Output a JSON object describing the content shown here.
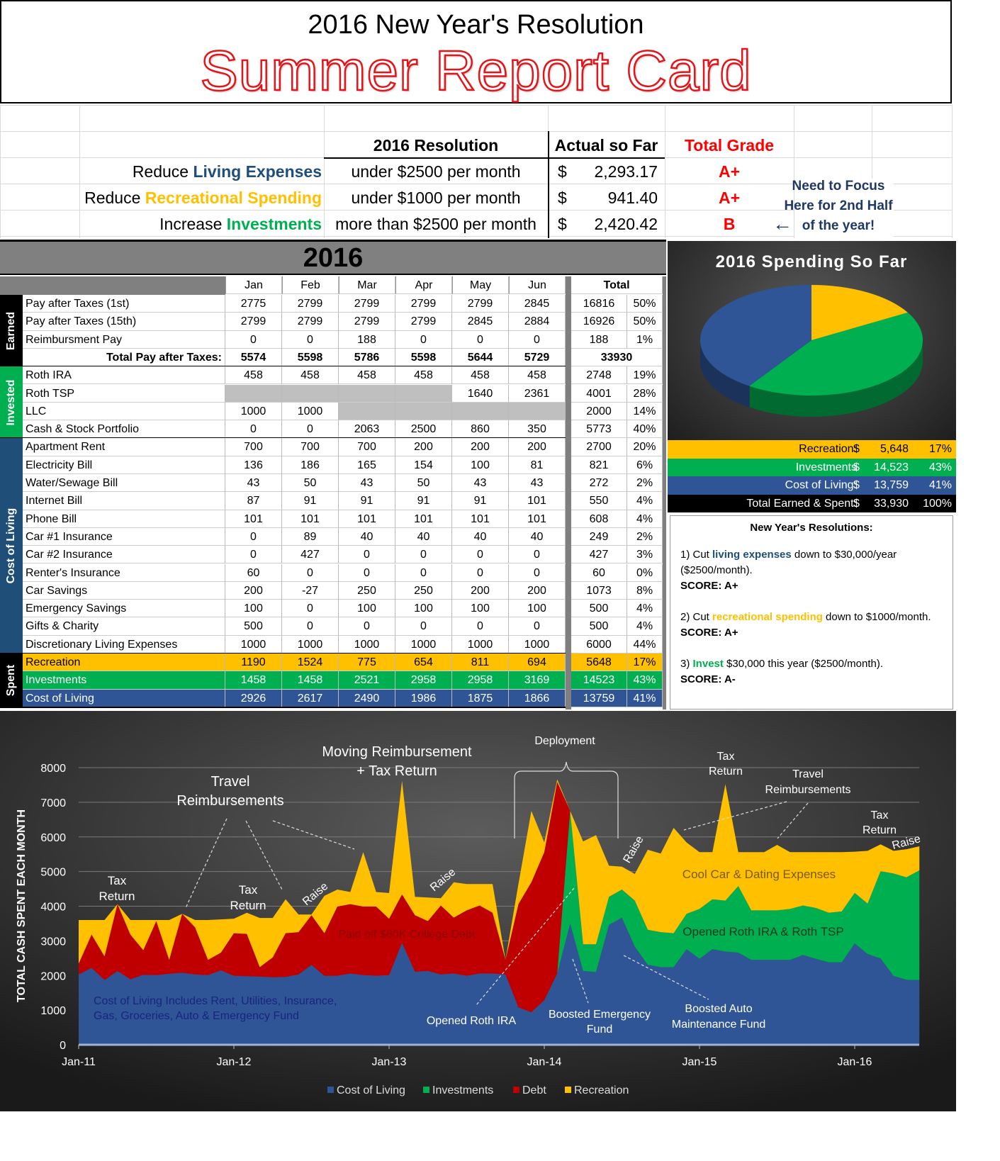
{
  "header": {
    "subtitle": "2016 New Year's Resolution",
    "title": "Summer Report Card"
  },
  "goals": {
    "col_resolution": "2016 Resolution",
    "col_actual": "Actual so Far",
    "col_grade": "Total Grade",
    "rows": [
      {
        "verb": "Reduce",
        "item": "Living Expenses",
        "target": "under $2500 per month",
        "currency": "$",
        "actual": "2,293.17",
        "grade": "A+",
        "color": "#1f4e79"
      },
      {
        "verb": "Reduce",
        "item": "Recreational Spending",
        "target": "under $1000 per month",
        "currency": "$",
        "actual": "941.40",
        "grade": "A+",
        "color": "#ffc000"
      },
      {
        "verb": "Increase",
        "item": "Investments",
        "target": "more than $2500 per month",
        "currency": "$",
        "actual": "2,420.42",
        "grade": "B",
        "color": "#00b050"
      }
    ],
    "focus_note": [
      "Need to Focus",
      "Here for 2nd Half",
      "of the year!"
    ],
    "arrow": "←"
  },
  "table": {
    "year": "2016",
    "months": [
      "Jan",
      "Feb",
      "Mar",
      "Apr",
      "May",
      "Jun"
    ],
    "total_label": "Total",
    "sections": [
      {
        "label": "Earned",
        "color": "#000000",
        "rows": [
          {
            "name": "Pay after Taxes (1st)",
            "values": [
              "2775",
              "2799",
              "2799",
              "2799",
              "2799",
              "2845"
            ],
            "total": "16816",
            "pct": "50%"
          },
          {
            "name": "Pay after Taxes (15th)",
            "values": [
              "2799",
              "2799",
              "2799",
              "2799",
              "2845",
              "2884"
            ],
            "total": "16926",
            "pct": "50%"
          },
          {
            "name": "Reimbursment Pay",
            "values": [
              "0",
              "0",
              "188",
              "0",
              "0",
              "0"
            ],
            "total": "188",
            "pct": "1%"
          },
          {
            "name": "Total Pay after Taxes:",
            "values": [
              "5574",
              "5598",
              "5786",
              "5598",
              "5644",
              "5729"
            ],
            "total": "33930",
            "pct": "",
            "bold": true
          }
        ]
      },
      {
        "label": "Invested",
        "color": "#00b050",
        "rows": [
          {
            "name": "Roth IRA",
            "values": [
              "458",
              "458",
              "458",
              "458",
              "458",
              "458"
            ],
            "total": "2748",
            "pct": "19%"
          },
          {
            "name": "Roth TSP",
            "values": [
              null,
              null,
              null,
              null,
              "1640",
              "2361"
            ],
            "total": "4001",
            "pct": "28%"
          },
          {
            "name": "LLC",
            "values": [
              "1000",
              "1000",
              null,
              null,
              null,
              null
            ],
            "total": "2000",
            "pct": "14%"
          },
          {
            "name": "Cash & Stock Portfolio",
            "values": [
              "0",
              "0",
              "2063",
              "2500",
              "860",
              "350"
            ],
            "total": "5773",
            "pct": "40%"
          }
        ]
      },
      {
        "label": "Cost of Living",
        "color": "#1f4e79",
        "rows": [
          {
            "name": "Apartment Rent",
            "values": [
              "700",
              "700",
              "700",
              "200",
              "200",
              "200"
            ],
            "total": "2700",
            "pct": "20%"
          },
          {
            "name": "Electricity Bill",
            "values": [
              "136",
              "186",
              "165",
              "154",
              "100",
              "81"
            ],
            "total": "821",
            "pct": "6%"
          },
          {
            "name": "Water/Sewage Bill",
            "values": [
              "43",
              "50",
              "43",
              "50",
              "43",
              "43"
            ],
            "total": "272",
            "pct": "2%"
          },
          {
            "name": "Internet Bill",
            "values": [
              "87",
              "91",
              "91",
              "91",
              "91",
              "101"
            ],
            "total": "550",
            "pct": "4%"
          },
          {
            "name": "Phone Bill",
            "values": [
              "101",
              "101",
              "101",
              "101",
              "101",
              "101"
            ],
            "total": "608",
            "pct": "4%"
          },
          {
            "name": "Car #1 Insurance",
            "values": [
              "0",
              "89",
              "40",
              "40",
              "40",
              "40"
            ],
            "total": "249",
            "pct": "2%"
          },
          {
            "name": "Car #2 Insurance",
            "values": [
              "0",
              "427",
              "0",
              "0",
              "0",
              "0"
            ],
            "total": "427",
            "pct": "3%"
          },
          {
            "name": "Renter's Insurance",
            "values": [
              "60",
              "0",
              "0",
              "0",
              "0",
              "0"
            ],
            "total": "60",
            "pct": "0%"
          },
          {
            "name": "Car Savings",
            "values": [
              "200",
              "-27",
              "250",
              "250",
              "200",
              "200"
            ],
            "total": "1073",
            "pct": "8%"
          },
          {
            "name": "Emergency Savings",
            "values": [
              "100",
              "0",
              "100",
              "100",
              "100",
              "100"
            ],
            "total": "500",
            "pct": "4%"
          },
          {
            "name": "Gifts & Charity",
            "values": [
              "500",
              "0",
              "0",
              "0",
              "0",
              "0"
            ],
            "total": "500",
            "pct": "4%"
          },
          {
            "name": "Discretionary Living Expenses",
            "values": [
              "1000",
              "1000",
              "1000",
              "1000",
              "1000",
              "1000"
            ],
            "total": "6000",
            "pct": "44%"
          }
        ]
      },
      {
        "label": "Spent",
        "color": "#000000",
        "rows": [
          {
            "name": "Recreation",
            "values": [
              "1190",
              "1524",
              "775",
              "654",
              "811",
              "694"
            ],
            "total": "5648",
            "pct": "17%",
            "bg": "#ffc000",
            "fg": "#000000"
          },
          {
            "name": "Investments",
            "values": [
              "1458",
              "1458",
              "2521",
              "2958",
              "2958",
              "3169"
            ],
            "total": "14523",
            "pct": "43%",
            "bg": "#00b050",
            "fg": "#ffffff"
          },
          {
            "name": "Cost of Living",
            "values": [
              "2926",
              "2617",
              "2490",
              "1986",
              "1875",
              "1866"
            ],
            "total": "13759",
            "pct": "41%",
            "bg": "#2f5597",
            "fg": "#ffffff"
          }
        ]
      }
    ]
  },
  "pie": {
    "title": "2016 Spending So Far",
    "slices": [
      {
        "label": "Recreation:",
        "value": 5648,
        "amount": "5,648",
        "pct": "17%",
        "color": "#ffc000",
        "fg": "#000000"
      },
      {
        "label": "Investments",
        "value": 14523,
        "amount": "14,523",
        "pct": "43%",
        "color": "#00b050",
        "fg": "#ffffff"
      },
      {
        "label": "Cost of Living:",
        "value": 13759,
        "amount": "13,759",
        "pct": "41%",
        "color": "#2f5597",
        "fg": "#ffffff"
      }
    ],
    "total": {
      "label": "Total Earned & Spent:",
      "amount": "33,930",
      "pct": "100%"
    },
    "currency": "$"
  },
  "notes": {
    "title": "New Year's Resolutions:",
    "items": [
      {
        "pre": "1) Cut ",
        "hl": "living expenses",
        "post": " down to $30,000/year ($2500/month).",
        "score": "SCORE: A+",
        "color": "#1f4e79"
      },
      {
        "pre": "2) Cut ",
        "hl": "recreational spending",
        "post": " down to $1000/month.",
        "score": "SCORE: A+",
        "color": "#ffc000"
      },
      {
        "pre": "3) ",
        "hl": "Invest",
        "post": " $30,000 this year ($2500/month).",
        "score": "SCORE: A-",
        "color": "#00b050"
      }
    ]
  },
  "chart_data": {
    "type": "area",
    "stacked": true,
    "ylabel": "TOTAL CASH SPENT EACH MONTH",
    "ylim": [
      0,
      8000
    ],
    "yticks": [
      "0",
      "1000",
      "2000",
      "3000",
      "4000",
      "5000",
      "6000",
      "7000",
      "8000"
    ],
    "xticks": [
      "Jan-11",
      "Jan-12",
      "Jan-13",
      "Jan-14",
      "Jan-15",
      "Jan-16"
    ],
    "x_range": "Jan-11 to Jun-16 (monthly)",
    "legend_position": "bottom",
    "series": [
      {
        "name": "Cost of Living",
        "color": "#2f5597",
        "values": [
          2030,
          2220,
          1870,
          2130,
          1890,
          2020,
          2010,
          2050,
          2080,
          2030,
          2010,
          2150,
          1990,
          1980,
          1970,
          1950,
          1960,
          2030,
          2310,
          1990,
          1990,
          2060,
          2010,
          1990,
          2010,
          2940,
          2110,
          2130,
          2030,
          2060,
          1990,
          2060,
          2060,
          2030,
          1080,
          940,
          1290,
          2060,
          3500,
          2130,
          2100,
          3460,
          3670,
          2830,
          2310,
          2240,
          2240,
          2760,
          2480,
          2760,
          2690,
          2660,
          2450,
          2450,
          2450,
          2450,
          2590,
          2480,
          2380,
          2380,
          2926,
          2617,
          2490,
          1986,
          1875,
          1866
        ]
      },
      {
        "name": "Investments",
        "color": "#00b050",
        "values": [
          0,
          0,
          0,
          0,
          0,
          0,
          0,
          0,
          0,
          0,
          0,
          0,
          0,
          0,
          0,
          0,
          0,
          0,
          0,
          0,
          0,
          0,
          0,
          0,
          0,
          0,
          0,
          0,
          0,
          0,
          0,
          0,
          0,
          0,
          0,
          0,
          0,
          0,
          3250,
          770,
          800,
          810,
          810,
          1330,
          1010,
          1010,
          980,
          1020,
          1440,
          1440,
          1470,
          1920,
          1430,
          1430,
          1430,
          1470,
          1430,
          1470,
          1430,
          1470,
          1458,
          1458,
          2521,
          2958,
          2958,
          3169
        ]
      },
      {
        "name": "Debt",
        "color": "#c00000",
        "values": [
          310,
          960,
          680,
          1930,
          1290,
          710,
          1560,
          400,
          1700,
          1360,
          440,
          510,
          1230,
          1220,
          270,
          570,
          1260,
          1220,
          1430,
          1230,
          2000,
          2000,
          1980,
          2000,
          1630,
          1400,
          1630,
          1440,
          1990,
          1610,
          1890,
          1960,
          1750,
          420,
          2980,
          3750,
          4270,
          5530,
          0,
          0,
          0,
          0,
          0,
          0,
          0,
          0,
          0,
          0,
          0,
          0,
          0,
          0,
          0,
          0,
          0,
          0,
          0,
          0,
          0,
          0,
          0,
          0,
          0,
          0,
          0,
          0
        ]
      },
      {
        "name": "Recreation",
        "color": "#ffc000",
        "values": [
          1260,
          420,
          1050,
          0,
          420,
          870,
          30,
          1150,
          0,
          210,
          1150,
          960,
          420,
          610,
          1420,
          1140,
          980,
          510,
          20,
          1080,
          490,
          350,
          1570,
          420,
          740,
          3280,
          530,
          680,
          210,
          1020,
          760,
          620,
          830,
          0,
          580,
          2060,
          280,
          70,
          0,
          2970,
          3150,
          900,
          660,
          770,
          2310,
          2270,
          3040,
          2060,
          1640,
          1360,
          3360,
          980,
          1680,
          1680,
          1890,
          1640,
          1540,
          1610,
          1750,
          1710,
          1190,
          1524,
          775,
          654,
          811,
          694
        ]
      }
    ],
    "annotations": [
      {
        "lines": [
          "Tax",
          "Return"
        ]
      },
      {
        "lines": [
          "Travel",
          "Reimbursements"
        ]
      },
      {
        "lines": [
          "Tax",
          "Return"
        ]
      },
      {
        "lines": [
          "Raise"
        ]
      },
      {
        "lines": [
          "Moving Reimbursement",
          "+ Tax Return"
        ]
      },
      {
        "lines": [
          "Raise"
        ]
      },
      {
        "lines": [
          "Paid off $60K College Debt"
        ]
      },
      {
        "lines": [
          "Deployment"
        ]
      },
      {
        "lines": [
          "Raise"
        ]
      },
      {
        "lines": [
          "Tax",
          "Return"
        ]
      },
      {
        "lines": [
          "Travel",
          "Reimbursements"
        ]
      },
      {
        "lines": [
          "Tax",
          "Return"
        ]
      },
      {
        "lines": [
          "Raise"
        ]
      },
      {
        "lines": [
          "Cool Car & Dating Expenses"
        ]
      },
      {
        "lines": [
          "Opened Roth IRA & Roth TSP"
        ]
      },
      {
        "lines": [
          "Cost of Living Includes Rent, Utilities, Insurance,",
          "Gas, Groceries, Auto & Emergency Fund"
        ]
      },
      {
        "lines": [
          "Opened Roth IRA"
        ]
      },
      {
        "lines": [
          "Boosted Emergency",
          "Fund"
        ]
      },
      {
        "lines": [
          "Boosted Auto",
          "Maintenance Fund"
        ]
      }
    ]
  }
}
